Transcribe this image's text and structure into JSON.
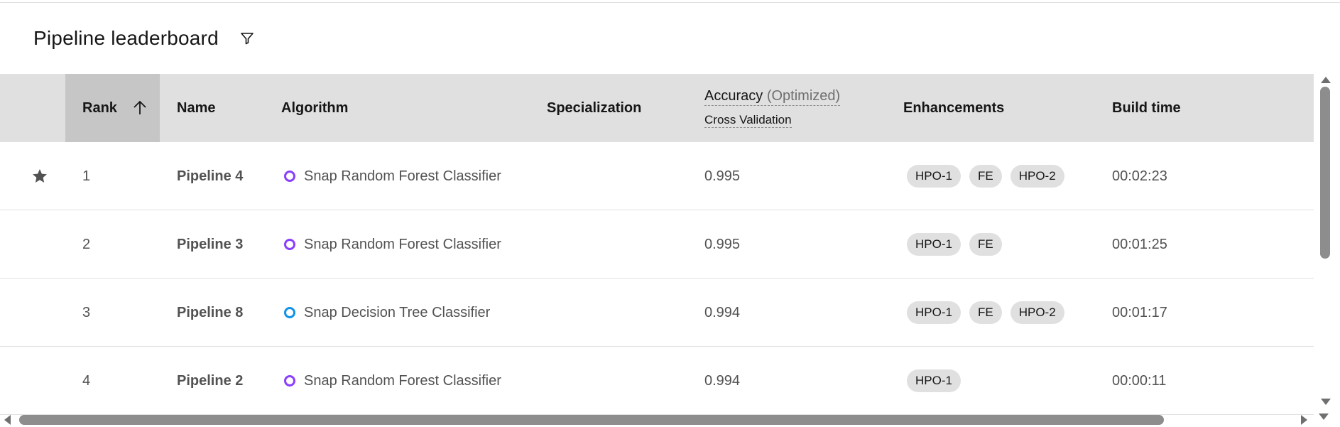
{
  "header": {
    "title": "Pipeline leaderboard"
  },
  "table": {
    "columns": {
      "rank": "Rank",
      "name": "Name",
      "algorithm": "Algorithm",
      "specialization": "Specialization",
      "accuracy": "Accuracy",
      "accuracy_qualifier": "(Optimized)",
      "accuracy_sub": "Cross Validation",
      "enhancements": "Enhancements",
      "build_time": "Build time"
    },
    "rows": [
      {
        "rank": "1",
        "name": "Pipeline 4",
        "algorithm": "Snap Random Forest Classifier",
        "algo_color": "#8a3ffc",
        "accuracy": "0.995",
        "tags": [
          "HPO-1",
          "FE",
          "HPO-2"
        ],
        "build_time": "00:02:23",
        "starred": true
      },
      {
        "rank": "2",
        "name": "Pipeline 3",
        "algorithm": "Snap Random Forest Classifier",
        "algo_color": "#8a3ffc",
        "accuracy": "0.995",
        "tags": [
          "HPO-1",
          "FE"
        ],
        "build_time": "00:01:25",
        "starred": false
      },
      {
        "rank": "3",
        "name": "Pipeline 8",
        "algorithm": "Snap Decision Tree Classifier",
        "algo_color": "#1192e8",
        "accuracy": "0.994",
        "tags": [
          "HPO-1",
          "FE",
          "HPO-2"
        ],
        "build_time": "00:01:17",
        "starred": false
      },
      {
        "rank": "4",
        "name": "Pipeline 2",
        "algorithm": "Snap Random Forest Classifier",
        "algo_color": "#8a3ffc",
        "accuracy": "0.994",
        "tags": [
          "HPO-1"
        ],
        "build_time": "00:00:11",
        "starred": false
      }
    ]
  },
  "icons": {
    "filter": "filter-icon",
    "sort": "arrow-up-icon",
    "star": "star-filled-icon"
  },
  "colors": {
    "header_bg": "#e0e0e0",
    "sorted_header_bg": "#c6c6c6",
    "tag_bg": "#e0e0e0"
  }
}
